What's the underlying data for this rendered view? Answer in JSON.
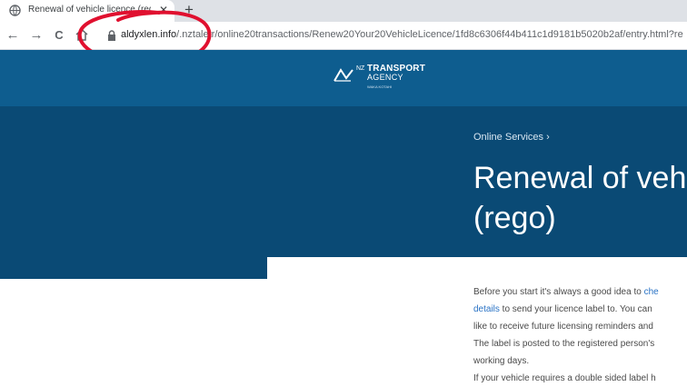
{
  "browser": {
    "tab_title": "Renewal of vehicle licence (rego)",
    "tab_close": "✕",
    "new_tab": "+",
    "back": "←",
    "forward": "→",
    "reload": "C",
    "url_host": "aldyxlen.info",
    "url_path": "/.nztaletr/online20transactions/Renew20Your20VehicleLicence/1fd8c6306f44b411c1d9181b5020b2af/entry.html?re",
    "annotation_color": "#e0102f"
  },
  "logo": {
    "nz": "NZ",
    "transport": "TRANSPORT",
    "agency": "AGENCY",
    "maori": "WAKA KOTAHI"
  },
  "page": {
    "breadcrumb": "Online Services ›",
    "title_line1": "Renewal of vehi",
    "title_line2": "(rego)",
    "body": {
      "l1a": "Before you start it's always a good idea to ",
      "l1b": "che",
      "l2a": "details",
      "l2b": " to send your licence label to. You can",
      "l3": "like to receive future licensing reminders and",
      "l4": "The label is posted to the registered person's",
      "l5": "working days.",
      "l6": "If your vehicle requires a double sided label h"
    }
  },
  "colors": {
    "header_blue": "#0e5d8f",
    "hero_blue": "#0a4a75",
    "link_blue": "#2a73c5"
  }
}
